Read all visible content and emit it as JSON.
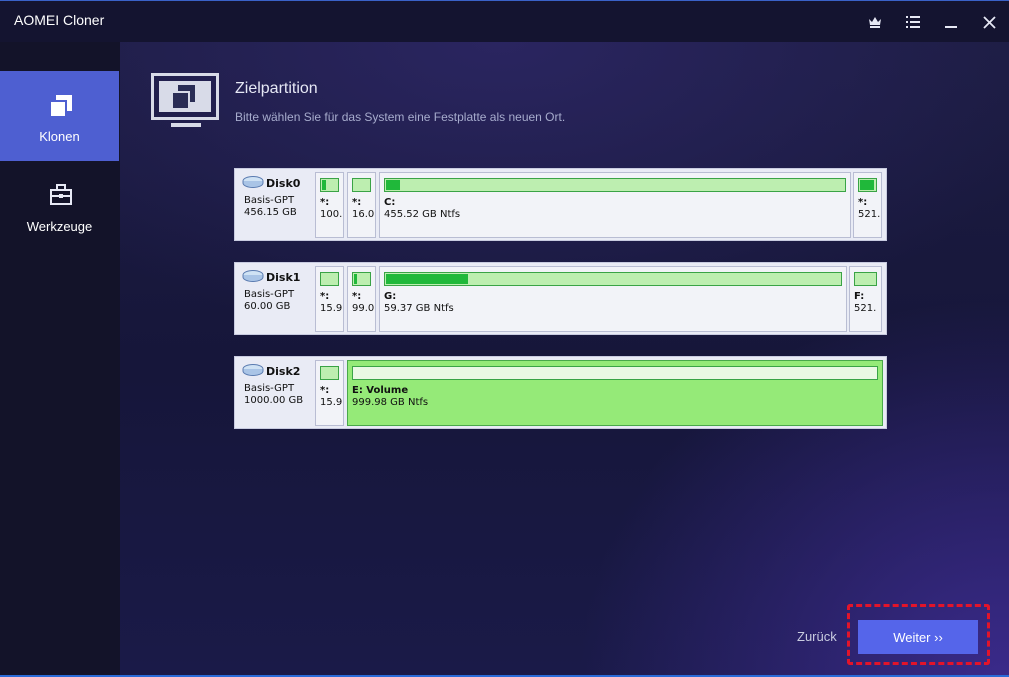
{
  "app": {
    "title": "AOMEI Cloner"
  },
  "titlebar": {
    "buttons": [
      {
        "name": "crown-icon"
      },
      {
        "name": "menu-icon"
      },
      {
        "name": "minimize-icon"
      },
      {
        "name": "close-icon"
      }
    ]
  },
  "sidebar": {
    "items": [
      {
        "label": "Klonen",
        "icon": "clone-icon",
        "active": true
      },
      {
        "label": "Werkzeuge",
        "icon": "toolbox-icon",
        "active": false
      }
    ]
  },
  "header": {
    "title": "Zielpartition",
    "subtitle": "Bitte wählen Sie für das System eine Festplatte als neuen Ort."
  },
  "disks": [
    {
      "name": "Disk0",
      "type": "Basis-GPT",
      "size": "456.15 GB",
      "partitions": [
        {
          "label": "*:",
          "size": "100.",
          "used_fraction": 0.25
        },
        {
          "label": "*:",
          "size": "16.0",
          "used_fraction": 0.0
        },
        {
          "label": "C:",
          "size": "455.52 GB Ntfs",
          "used_fraction": 0.03
        },
        {
          "label": "*:",
          "size": "521.",
          "used_fraction": 0.85
        }
      ]
    },
    {
      "name": "Disk1",
      "type": "Basis-GPT",
      "size": "60.00 GB",
      "partitions": [
        {
          "label": "*:",
          "size": "15.9",
          "used_fraction": 0.0
        },
        {
          "label": "*:",
          "size": "99.0",
          "used_fraction": 0.2
        },
        {
          "label": "G:",
          "size": "59.37 GB Ntfs",
          "used_fraction": 0.18
        },
        {
          "label": "F:",
          "size": "521.",
          "used_fraction": 0.0
        }
      ]
    },
    {
      "name": "Disk2",
      "type": "Basis-GPT",
      "size": "1000.00 GB",
      "partitions": [
        {
          "label": "*:",
          "size": "15.9",
          "used_fraction": 0.0
        },
        {
          "label": "E: Volume",
          "size": "999.98 GB Ntfs",
          "used_fraction": 0.0,
          "selected": true
        }
      ]
    }
  ],
  "footer": {
    "back_label": "Zurück",
    "next_label": "Weiter ››"
  },
  "colors": {
    "accent": "#5565ea",
    "highlight": "#e3142a",
    "selected_partition": "#95ea78",
    "usage_fill": "#20b83a"
  }
}
